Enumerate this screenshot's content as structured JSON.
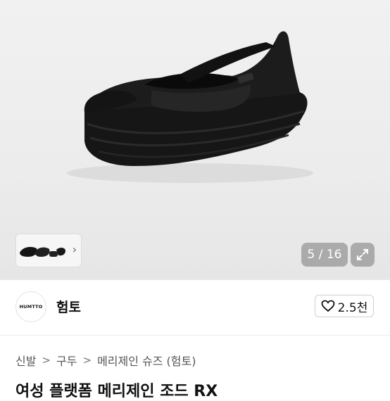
{
  "gallery": {
    "counter": "5 / 16",
    "thumb_chevron": "›",
    "colors": {
      "background": "#eeeeee",
      "overlay": "rgba(120,120,120,0.55)"
    }
  },
  "seller": {
    "logo_text": "HUMTTO",
    "name": "험토",
    "likes": "2.5천"
  },
  "breadcrumb": {
    "items": [
      "신발",
      "구두",
      "메리제인 슈즈 (험토)"
    ],
    "separator": ">"
  },
  "product": {
    "title": "여성 플랫폼 메리제인 조드 RX"
  },
  "icons": [
    "heart-icon",
    "expand-icon",
    "chevron-right-icon"
  ]
}
